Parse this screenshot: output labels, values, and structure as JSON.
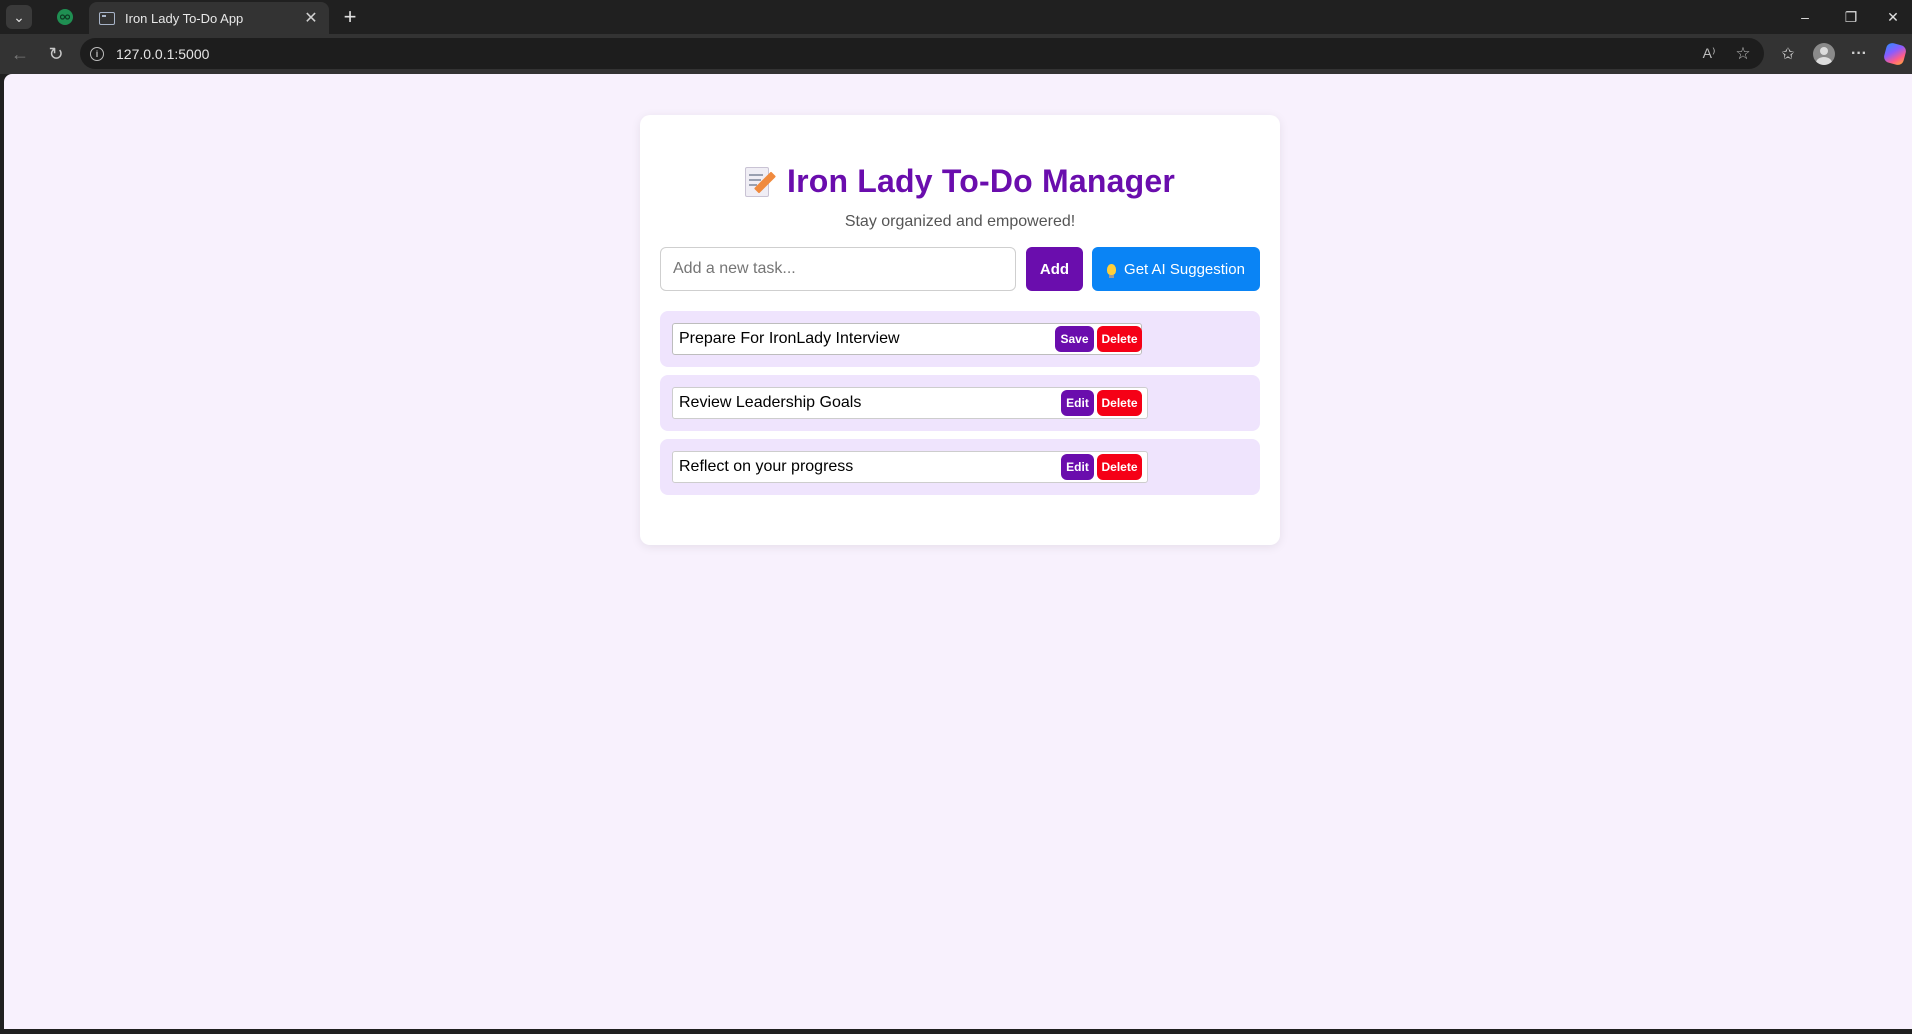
{
  "browser": {
    "tab_title": "Iron Lady To-Do App",
    "url": "127.0.0.1:5000",
    "new_tab_glyph": "+",
    "close_tab_glyph": "✕",
    "back_glyph": "←",
    "reload_glyph": "↻",
    "read_aloud_glyph": "A⁾",
    "favorite_glyph": "☆",
    "favorites_bar_glyph": "✩",
    "more_glyph": "···",
    "minimize_glyph": "–",
    "restore_glyph": "❐",
    "close_window_glyph": "✕",
    "tab_menu_glyph": "⌄"
  },
  "app": {
    "title": "Iron Lady To-Do Manager",
    "subtitle": "Stay organized and empowered!",
    "input_placeholder": "Add a new task...",
    "add_label": "Add",
    "ai_label": "Get AI Suggestion",
    "accent_color": "#6a0dad",
    "ai_button_color": "#0a84f5",
    "delete_color": "#f50016",
    "tasks": [
      {
        "text": "Prepare For IronLady Interview",
        "action_label": "Save",
        "delete_label": "Delete",
        "editing": true
      },
      {
        "text": "Review Leadership Goals",
        "action_label": "Edit",
        "delete_label": "Delete",
        "editing": false
      },
      {
        "text": "Reflect on your progress",
        "action_label": "Edit",
        "delete_label": "Delete",
        "editing": false
      }
    ]
  }
}
